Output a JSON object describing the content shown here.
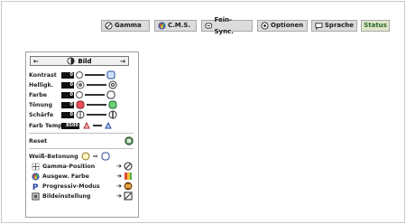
{
  "tabs": [
    {
      "label": "Gamma",
      "icon": "gamma-icon"
    },
    {
      "label": "C.M.S.",
      "icon": "cms-icon"
    },
    {
      "label": "Fein-Sync.",
      "icon": "fine-sync-icon"
    },
    {
      "label": "Optionen",
      "icon": "options-icon"
    },
    {
      "label": "Sprache",
      "icon": "language-icon"
    },
    {
      "label": "Status",
      "icon": ""
    }
  ],
  "panel": {
    "title": "Bild",
    "left_arrow": "←",
    "right_arrow": "→",
    "adjust_rows": [
      {
        "label": "Kontrast",
        "value": "0"
      },
      {
        "label": "Helligk.",
        "value": "0"
      },
      {
        "label": "Farbe",
        "value": "0"
      },
      {
        "label": "Tönung",
        "value": "0"
      },
      {
        "label": "Schärfe",
        "value": "0"
      }
    ],
    "color_temp": {
      "label": "Farb Temp",
      "value": "8500"
    },
    "reset": "Reset",
    "white_boost": "Weiß-Betonung",
    "submenu": [
      {
        "label": "Gamma-Position",
        "icon": "gamma-position-icon"
      },
      {
        "label": "Ausgew. Farbe",
        "icon": "selected-color-icon"
      },
      {
        "label": "Progressiv-Modus",
        "icon": "progressive-mode-icon"
      },
      {
        "label": "Bildeinstellung",
        "icon": "picture-setting-icon"
      }
    ],
    "arrow": "➔"
  }
}
